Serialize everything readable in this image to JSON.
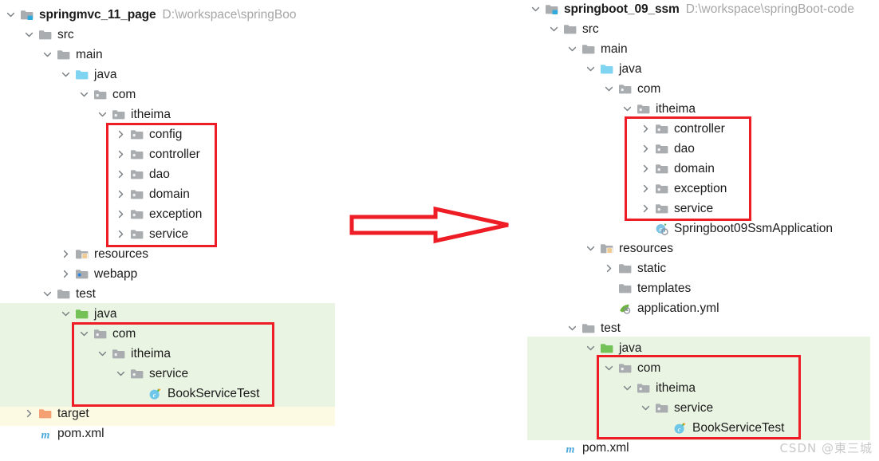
{
  "left_project": {
    "name": "springmvc_11_page",
    "path": "D:\\workspace\\springBoo",
    "rows": [
      {
        "label": "springmvc_11_page",
        "icon": "module-folder-icon",
        "chev": "down",
        "indent": 0,
        "bold": true,
        "path": "D:\\workspace\\springBoo"
      },
      {
        "label": "src",
        "icon": "folder-gray-icon",
        "chev": "down",
        "indent": 1
      },
      {
        "label": "main",
        "icon": "folder-gray-icon",
        "chev": "down",
        "indent": 2
      },
      {
        "label": "java",
        "icon": "folder-source-blue-icon",
        "chev": "down",
        "indent": 3
      },
      {
        "label": "com",
        "icon": "folder-package-icon",
        "chev": "down",
        "indent": 4
      },
      {
        "label": "itheima",
        "icon": "folder-package-icon",
        "chev": "down",
        "indent": 5
      },
      {
        "label": "config",
        "icon": "folder-package-icon",
        "chev": "right",
        "indent": 6
      },
      {
        "label": "controller",
        "icon": "folder-package-icon",
        "chev": "right",
        "indent": 6
      },
      {
        "label": "dao",
        "icon": "folder-package-icon",
        "chev": "right",
        "indent": 6
      },
      {
        "label": "domain",
        "icon": "folder-package-icon",
        "chev": "right",
        "indent": 6
      },
      {
        "label": "exception",
        "icon": "folder-package-icon",
        "chev": "right",
        "indent": 6
      },
      {
        "label": "service",
        "icon": "folder-package-icon",
        "chev": "right",
        "indent": 6
      },
      {
        "label": "resources",
        "icon": "folder-resources-icon",
        "chev": "right",
        "indent": 3
      },
      {
        "label": "webapp",
        "icon": "folder-webapp-icon",
        "chev": "right",
        "indent": 3
      },
      {
        "label": "test",
        "icon": "folder-gray-icon",
        "chev": "down",
        "indent": 2
      },
      {
        "label": "java",
        "icon": "folder-test-green-icon",
        "chev": "down",
        "indent": 3
      },
      {
        "label": "com",
        "icon": "folder-package-icon",
        "chev": "down",
        "indent": 4
      },
      {
        "label": "itheima",
        "icon": "folder-package-icon",
        "chev": "down",
        "indent": 5
      },
      {
        "label": "service",
        "icon": "folder-package-icon",
        "chev": "down",
        "indent": 6
      },
      {
        "label": "BookServiceTest",
        "icon": "java-test-class-icon",
        "chev": "none",
        "indent": 7
      },
      {
        "label": "target",
        "icon": "folder-target-orange-icon",
        "chev": "right",
        "indent": 1
      },
      {
        "label": "pom.xml",
        "icon": "maven-pom-icon",
        "chev": "none",
        "indent": 1
      }
    ]
  },
  "right_project": {
    "name": "springboot_09_ssm",
    "path": "D:\\workspace\\springBoot-code",
    "rows": [
      {
        "label": "springboot_09_ssm",
        "icon": "module-folder-icon",
        "chev": "down",
        "indent": 0,
        "bold": true,
        "path": "D:\\workspace\\springBoot-code"
      },
      {
        "label": "src",
        "icon": "folder-gray-icon",
        "chev": "down",
        "indent": 1
      },
      {
        "label": "main",
        "icon": "folder-gray-icon",
        "chev": "down",
        "indent": 2
      },
      {
        "label": "java",
        "icon": "folder-source-blue-icon",
        "chev": "down",
        "indent": 3
      },
      {
        "label": "com",
        "icon": "folder-package-icon",
        "chev": "down",
        "indent": 4
      },
      {
        "label": "itheima",
        "icon": "folder-package-icon",
        "chev": "down",
        "indent": 5
      },
      {
        "label": "controller",
        "icon": "folder-package-icon",
        "chev": "right",
        "indent": 6
      },
      {
        "label": "dao",
        "icon": "folder-package-icon",
        "chev": "right",
        "indent": 6
      },
      {
        "label": "domain",
        "icon": "folder-package-icon",
        "chev": "right",
        "indent": 6
      },
      {
        "label": "exception",
        "icon": "folder-package-icon",
        "chev": "right",
        "indent": 6
      },
      {
        "label": "service",
        "icon": "folder-package-icon",
        "chev": "right",
        "indent": 6
      },
      {
        "label": "Springboot09SsmApplication",
        "icon": "spring-boot-class-icon",
        "chev": "none",
        "indent": 6
      },
      {
        "label": "resources",
        "icon": "folder-resources-icon",
        "chev": "down",
        "indent": 3
      },
      {
        "label": "static",
        "icon": "folder-gray-icon",
        "chev": "right",
        "indent": 4
      },
      {
        "label": "templates",
        "icon": "folder-gray-icon",
        "chev": "none",
        "indent": 4
      },
      {
        "label": "application.yml",
        "icon": "spring-yml-icon",
        "chev": "none",
        "indent": 4
      },
      {
        "label": "test",
        "icon": "folder-gray-icon",
        "chev": "down",
        "indent": 2
      },
      {
        "label": "java",
        "icon": "folder-test-green-icon",
        "chev": "down",
        "indent": 3
      },
      {
        "label": "com",
        "icon": "folder-package-icon",
        "chev": "down",
        "indent": 4
      },
      {
        "label": "itheima",
        "icon": "folder-package-icon",
        "chev": "down",
        "indent": 5
      },
      {
        "label": "service",
        "icon": "folder-package-icon",
        "chev": "down",
        "indent": 6
      },
      {
        "label": "BookServiceTest",
        "icon": "java-test-class-icon",
        "chev": "none",
        "indent": 7
      },
      {
        "label": "pom.xml",
        "icon": "maven-pom-icon",
        "chev": "none",
        "indent": 1
      }
    ]
  },
  "annotations": {
    "arrow": {
      "name": "red-arrow-right",
      "color": "#ee1c25"
    },
    "boxes": [
      {
        "name": "left-main-packages-box",
        "color": "#ee1c25"
      },
      {
        "name": "left-test-packages-box",
        "color": "#ee1c25"
      },
      {
        "name": "right-main-packages-box",
        "color": "#ee1c25"
      },
      {
        "name": "right-test-packages-box",
        "color": "#ee1c25"
      }
    ]
  },
  "colors": {
    "red": "#ee1c25",
    "highlight_green": "#eaf4e3",
    "highlight_yellow": "#fdfae3",
    "path_gray": "#a6a6a6",
    "text": "#1b1b1b"
  },
  "watermark": {
    "text": "CSDN @東三城"
  }
}
